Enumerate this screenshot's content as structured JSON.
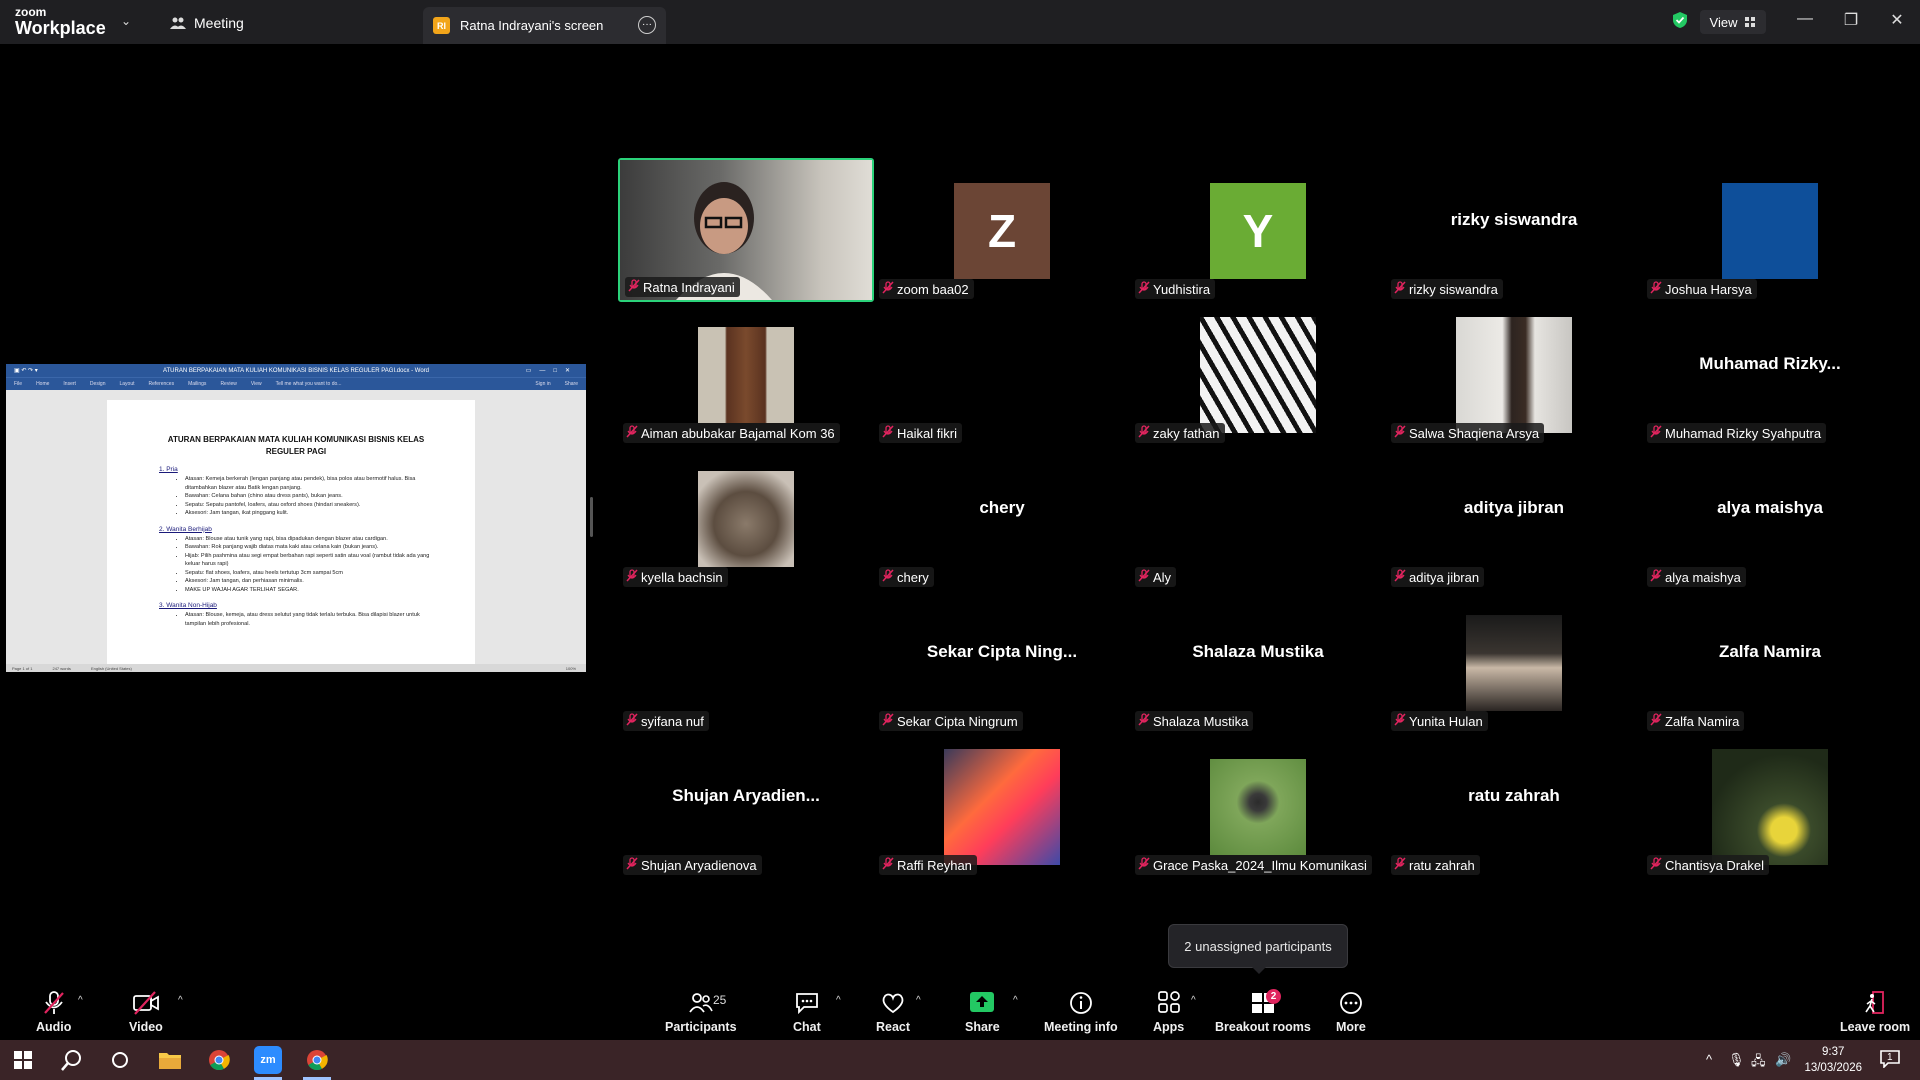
{
  "app": {
    "brand_top": "zoom",
    "brand_bottom": "Workplace"
  },
  "titlebar": {
    "meeting_tab": "Meeting",
    "screen_tab": {
      "initials": "RI",
      "label": "Ratna Indrayani's screen"
    },
    "view_label": "View"
  },
  "shared_doc": {
    "window_title": "ATURAN BERPAKAIAN MATA KULIAH KOMUNIKASI BISNIS KELAS REGULER PAGI.docx - Word",
    "ribbon_tabs": [
      "File",
      "Home",
      "Insert",
      "Design",
      "Layout",
      "References",
      "Mailings",
      "Review",
      "View",
      "Tell me what you want to do...",
      "Sign in",
      "Share"
    ],
    "doc_title_line1": "ATURAN BERPAKAIAN MATA KULIAH KOMUNIKASI BISNIS KELAS",
    "doc_title_line2": "REGULER PAGI",
    "sections": [
      {
        "heading": "1. Pria",
        "items": [
          "Atasan: Kemeja berkerah (lengan panjang atau pendek), bisa polos atau bermotif halus. Bisa ditambahkan blazer atau Batik lengan panjang.",
          "Bawahan: Celana bahan (chino atau dress pants), bukan jeans.",
          "Sepatu: Sepatu pantofel, loafers, atau oxford shoes (hindari sneakers).",
          "Aksesori: Jam tangan, ikat pinggang kulit."
        ]
      },
      {
        "heading": "2. Wanita Berhijab",
        "items": [
          "Atasan: Blouse atau tunik yang rapi, bisa dipadukan dengan blazer atau cardigan.",
          "Bawahan: Rok panjang wajib diatas mata kaki atau celana kain (bukan jeans).",
          "Hijab: Pilih pashmina atau segi empat berbahan rapi seperti satin atau voal (rambut tidak ada yang keluar harus rapi)",
          "Sepatu: flat shoes, loafers, atau heels tertutup 3cm sampai 5cm",
          "Aksesori: Jam tangan, dan perhiasan minimalis.",
          "MAKE UP WAJAH AGAR TERLIHAT SEGAR."
        ]
      },
      {
        "heading": "3. Wanita Non-Hijab",
        "items": [
          "Atasan: Blouse, kemeja, atau dress selutut yang tidak terlalu terbuka. Bisa dilapisi blazer untuk tampilan lebih profesional."
        ]
      }
    ],
    "status_bar": [
      "Page 1 of 1",
      "247 words",
      "English (United States)",
      "100%"
    ]
  },
  "participants": [
    {
      "name": "Ratna Indrayani",
      "type": "video"
    },
    {
      "name": "zoom baa02",
      "type": "letter",
      "letter": "Z",
      "color": "#6b4535"
    },
    {
      "name": "Yudhistira",
      "type": "letter",
      "letter": "Y",
      "color": "#6aac34"
    },
    {
      "name": "rizky siswandra",
      "type": "text",
      "display": "rizky siswandra"
    },
    {
      "name": "Joshua Harsya",
      "type": "avatar"
    },
    {
      "name": "Aiman abubakar Bajamal Kom 36",
      "type": "avatar"
    },
    {
      "name": "Haikal fikri",
      "type": "avatar"
    },
    {
      "name": "zaky fathan",
      "type": "avatar"
    },
    {
      "name": "Salwa Shaqiena Arsya",
      "type": "avatar"
    },
    {
      "name": "Muhamad Rizky Syahputra",
      "type": "text",
      "display": "Muhamad Rizky..."
    },
    {
      "name": "kyella bachsin",
      "type": "avatar"
    },
    {
      "name": "chery",
      "type": "text",
      "display": "chery"
    },
    {
      "name": "Aly",
      "type": "avatar"
    },
    {
      "name": "aditya jibran",
      "type": "text",
      "display": "aditya jibran"
    },
    {
      "name": "alya maishya",
      "type": "text",
      "display": "alya maishya"
    },
    {
      "name": "syifana nuf",
      "type": "avatar"
    },
    {
      "name": "Sekar Cipta Ningrum",
      "type": "text",
      "display": "Sekar Cipta Ning..."
    },
    {
      "name": "Shalaza Mustika",
      "type": "text",
      "display": "Shalaza Mustika"
    },
    {
      "name": "Yunita Hulan",
      "type": "avatar"
    },
    {
      "name": "Zalfa Namira",
      "type": "text",
      "display": "Zalfa Namira"
    },
    {
      "name": "Shujan Aryadienova",
      "type": "text",
      "display": "Shujan Aryadien..."
    },
    {
      "name": "Raffi Reyhan",
      "type": "avatar"
    },
    {
      "name": "Grace Paska_2024_Ilmu Komunikasi",
      "type": "avatar"
    },
    {
      "name": "ratu zahrah",
      "type": "text",
      "display": "ratu zahrah"
    },
    {
      "name": "Chantisya Drakel",
      "type": "avatar"
    }
  ],
  "tooltip": "2 unassigned participants",
  "toolbar": {
    "audio": "Audio",
    "video": "Video",
    "participants": "Participants",
    "participants_count": "25",
    "chat": "Chat",
    "react": "React",
    "share": "Share",
    "meeting_info": "Meeting info",
    "apps": "Apps",
    "breakout_rooms": "Breakout rooms",
    "breakout_badge": "2",
    "more": "More",
    "leave": "Leave room"
  },
  "taskbar": {
    "time": "9:37",
    "date": "13/03/2026",
    "notif_count": "1"
  },
  "colors": {
    "active_speaker": "#2bd27a",
    "zoom_blue": "#2d8cff",
    "share_green": "#23c863",
    "taskbar": "#3a2427"
  }
}
